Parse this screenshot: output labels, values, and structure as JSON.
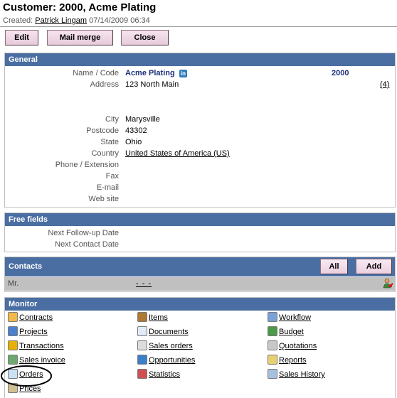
{
  "header": {
    "title": "Customer: 2000, Acme Plating",
    "created_label": "Created:",
    "created_by": "Patrick Lingam",
    "created_at": "07/14/2009 06:34"
  },
  "toolbar": {
    "edit": "Edit",
    "mail_merge": "Mail merge",
    "close": "Close"
  },
  "general": {
    "heading": "General",
    "name_label": "Name / Code",
    "name": "Acme Plating",
    "code": "2000",
    "address_label": "Address",
    "address": "123 North Main",
    "address_count": "(4)",
    "city_label": "City",
    "city": "Marysville",
    "postcode_label": "Postcode",
    "postcode": "43302",
    "state_label": "State",
    "state": "Ohio",
    "country_label": "Country",
    "country": "United States of America (US)",
    "phone_label": "Phone / Extension",
    "fax_label": "Fax",
    "email_label": "E-mail",
    "website_label": "Web site",
    "linkedin_icon": "in"
  },
  "free_fields": {
    "heading": "Free fields",
    "followup_label": "Next Follow-up Date",
    "contact_label": "Next Contact Date"
  },
  "contacts": {
    "heading": "Contacts",
    "all_button": "All",
    "add_button": "Add",
    "row_title": "Mr.",
    "row_name": "- - -"
  },
  "monitor": {
    "heading": "Monitor",
    "col1": [
      "Contracts",
      "Projects",
      "Transactions",
      "Sales invoice",
      "Orders",
      "Prices"
    ],
    "col2": [
      "Items",
      "Documents",
      "Sales orders",
      "Opportunities",
      "Statistics"
    ],
    "col3": [
      "Workflow",
      "Budget",
      "Quotations",
      "Reports",
      "Sales History"
    ]
  },
  "colors": {
    "panel_header": "#4a6ea2",
    "button_bg": "#f0d8e6",
    "contacts_row": "#c0c0c0"
  }
}
